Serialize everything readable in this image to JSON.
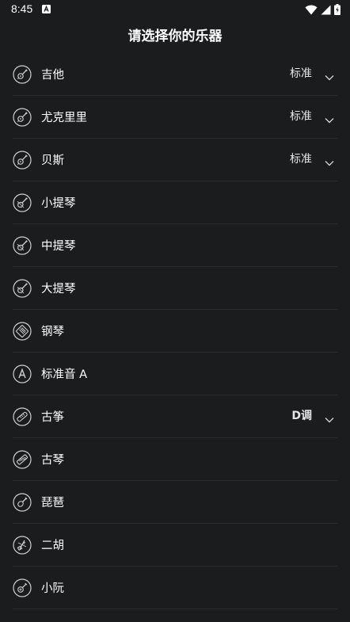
{
  "status_bar": {
    "time": "8:45",
    "icons": [
      "notification-a-icon",
      "wifi-icon",
      "signal-icon",
      "battery-charging-icon"
    ]
  },
  "header": {
    "title": "请选择你的乐器"
  },
  "instruments": [
    {
      "name": "吉他",
      "icon": "guitar-icon",
      "tuning": "标准"
    },
    {
      "name": "尤克里里",
      "icon": "guitar-icon",
      "tuning": "标准"
    },
    {
      "name": "贝斯",
      "icon": "guitar-icon",
      "tuning": "标准"
    },
    {
      "name": "小提琴",
      "icon": "violin-icon",
      "tuning": ""
    },
    {
      "name": "中提琴",
      "icon": "violin-icon",
      "tuning": ""
    },
    {
      "name": "大提琴",
      "icon": "violin-icon",
      "tuning": ""
    },
    {
      "name": "钢琴",
      "icon": "piano-icon",
      "tuning": ""
    },
    {
      "name": "标准音 A",
      "icon": "letter-a-icon",
      "tuning": ""
    },
    {
      "name": "古筝",
      "icon": "guzheng-icon",
      "tuning": "D调"
    },
    {
      "name": "古琴",
      "icon": "guqin-icon",
      "tuning": ""
    },
    {
      "name": "琵琶",
      "icon": "pipa-icon",
      "tuning": ""
    },
    {
      "name": "二胡",
      "icon": "erhu-icon",
      "tuning": ""
    },
    {
      "name": "小阮",
      "icon": "ruan-icon",
      "tuning": ""
    }
  ],
  "colors": {
    "background": "#1b1c1e",
    "divider": "#2a2b2e",
    "text": "#ffffff",
    "icon_stroke": "#cfcfcf"
  }
}
